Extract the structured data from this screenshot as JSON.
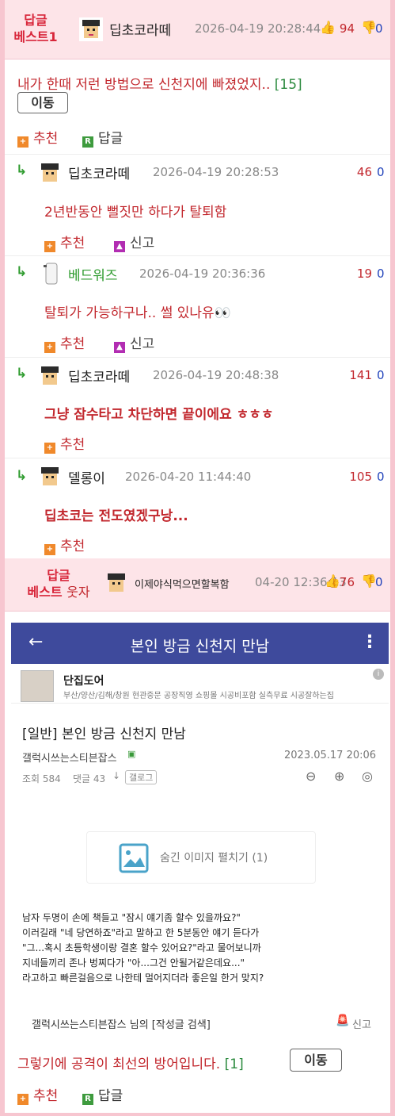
{
  "best1": {
    "label_line1": "답글",
    "label_line2": "베스트1",
    "nick": "딥초코라떼",
    "time": "2026-04-19 20:28:44",
    "up": "94",
    "down": "0",
    "comment": "내가 한때 저런 방법으로 신천지에 빠졌었지..",
    "count": "[15]",
    "move_label": "이동",
    "recommend_label": "추천",
    "reply_label": "답글"
  },
  "replies": [
    {
      "nick": "딥초코라떼",
      "time": "2026-04-19 20:28:53",
      "up": "46",
      "down": "0",
      "comment": "2년반동안 뻘짓만 하다가 탈퇴함",
      "bold": false,
      "has_report": true
    },
    {
      "nick": "베드워즈",
      "time": "2026-04-19 20:36:36",
      "up": "19",
      "down": "0",
      "comment": "탈퇴가 가능하구나.. 썰 있나유👀",
      "bold": false,
      "has_report": true,
      "nick_color": "#2e9b2e"
    },
    {
      "nick": "딥초코라떼",
      "time": "2026-04-19 20:48:38",
      "up": "141",
      "down": "0",
      "comment": "그냥 잠수타고 차단하면 끝이에요 ㅎㅎㅎ",
      "bold": true,
      "has_report": false
    },
    {
      "nick": "델롱이",
      "time": "2026-04-20 11:44:40",
      "up": "105",
      "down": "0",
      "comment": "딥초코는 전도였겠구낭...",
      "bold": true,
      "has_report": false
    }
  ],
  "labels": {
    "recommend": "추천",
    "report": "신고",
    "reply": "답글"
  },
  "best2": {
    "label_line1": "답글",
    "label_line2": "베스트",
    "label_suffix": "웃자",
    "nick": "이제야식먹으면할복함",
    "time": "04-20 12:36:13",
    "up": "76",
    "down": "0"
  },
  "shot": {
    "bar_title": "본인 방금 신천지 만남",
    "ad_title": "단집도어",
    "ad_sub": "부산/양산/김해/창원 현관중문 공장직영 쇼핑몰 시공비포함 실측무료 시공잘하는집",
    "post_title": "[일반] 본인 방금 신천지 만남",
    "author": "갤럭시쓰는스티븐잡스",
    "date": "2023.05.17 20:06",
    "views": "조회 584",
    "comments": "댓글 43",
    "gallog": "갤로그",
    "hidden_image": "숨긴 이미지 펼치기 (1)",
    "body": [
      "남자 두명이 손에 책들고 \"잠시 얘기좀 할수 있을까요?\"",
      "이러길래 \"네 당연하죠\"라고 말하고 한 5분동안 얘기 듣다가",
      "\"그...혹시 초등학생이랑 결혼 할수 있어요?\"라고 물어보니까",
      "지네들끼리 존나 벙찌다가 \"아...그건 안될거같은데요...\"",
      "라고하고 빠른걸음으로 나한테 멀어지더라 좋은일 한거 맞지?"
    ],
    "search_text": "갤럭시쓰는스티븐잡스 님의 [작성글 검색]",
    "report": "신고"
  },
  "footer": {
    "comment": "그렇기에 공격이 최선의 방어입니다.",
    "count": "[1]",
    "move_label": "이동",
    "recommend_label": "추천",
    "reply_label": "답글"
  },
  "colors": {
    "best_bg": "#fde4e8",
    "accent_red": "#c2272d",
    "bar": "#3e4a9c",
    "border": "#f7c6d0"
  }
}
